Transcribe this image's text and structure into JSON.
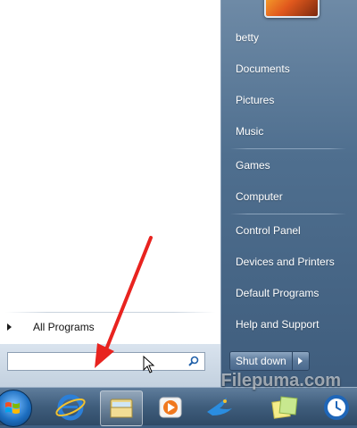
{
  "left_panel": {
    "all_programs_label": "All Programs"
  },
  "search": {
    "value": "",
    "placeholder": ""
  },
  "right_panel": {
    "user_name": "betty",
    "items": [
      {
        "label": "Documents"
      },
      {
        "label": "Pictures"
      },
      {
        "label": "Music"
      },
      {
        "label": "Games"
      },
      {
        "label": "Computer"
      },
      {
        "label": "Control Panel"
      },
      {
        "label": "Devices and Printers"
      },
      {
        "label": "Default Programs"
      },
      {
        "label": "Help and Support"
      }
    ]
  },
  "shutdown": {
    "label": "Shut down"
  },
  "taskbar": {
    "icons": [
      "start-orb-icon",
      "internet-explorer-icon",
      "windows-explorer-icon",
      "media-player-icon",
      "bird-app-icon",
      "sticky-notes-icon",
      "clock-app-icon"
    ]
  },
  "watermark": "Filepuma.com",
  "colors": {
    "annotation_arrow": "#e8231f",
    "start_menu_right": "#4f6f8f",
    "taskbar": "#3f5d7c"
  }
}
